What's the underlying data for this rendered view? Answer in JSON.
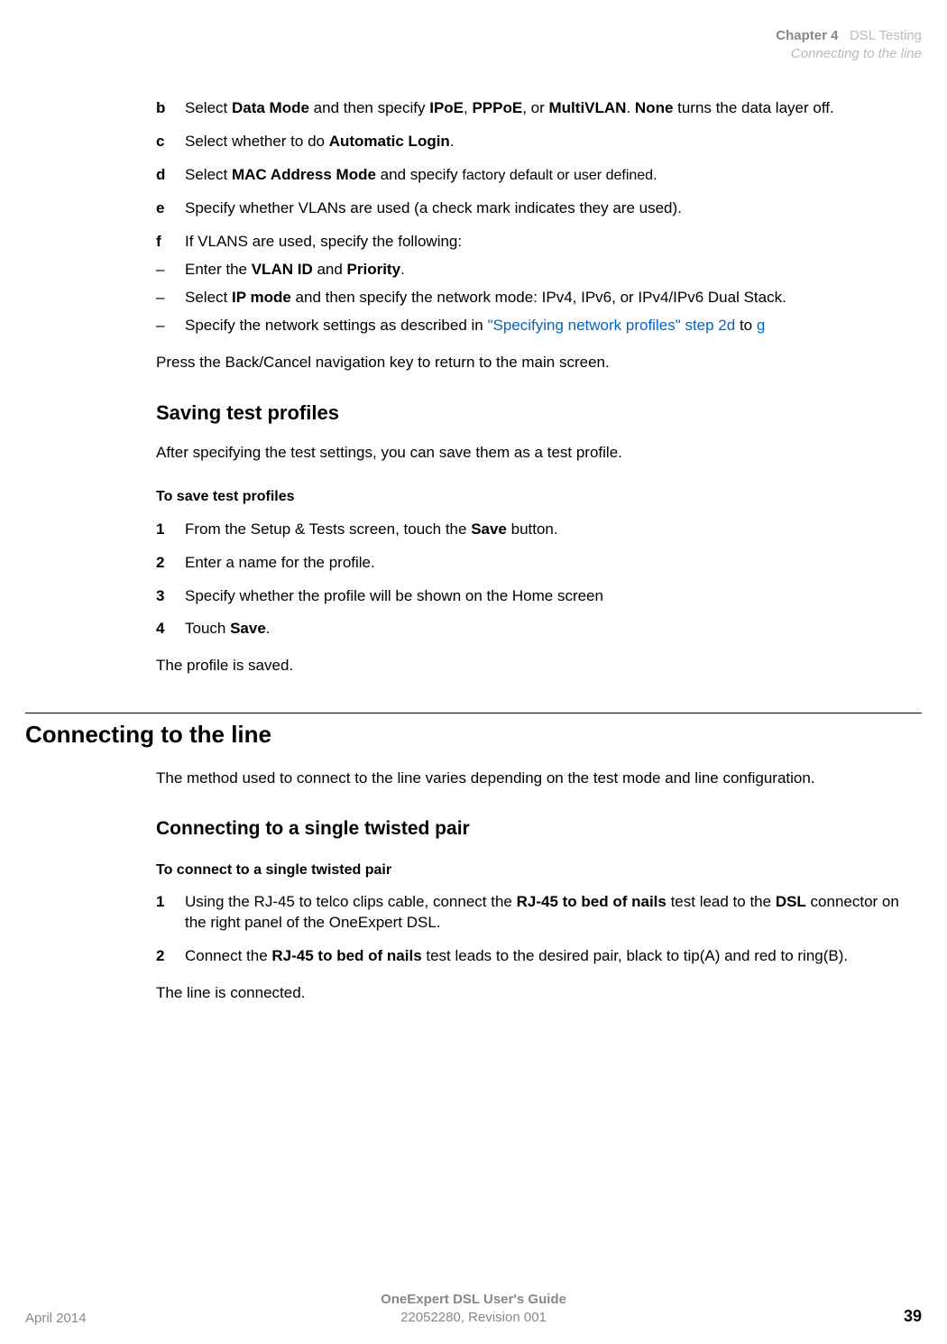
{
  "header": {
    "chapter": "Chapter 4",
    "chapter_title": "DSL Testing",
    "section": "Connecting to the line"
  },
  "intro_steps": {
    "b": {
      "prefix": "Select ",
      "bold1": "Data Mode",
      "mid1": " and then specify ",
      "bold2": "IPoE",
      "mid2": ", ",
      "bold3": "PPPoE",
      "mid3": ", or ",
      "bold4": "MultiVLAN",
      "mid4": ". ",
      "bold5": "None",
      "suffix": " turns the data layer off."
    },
    "c": {
      "prefix": "Select whether to do ",
      "bold1": "Automatic Login",
      "suffix": "."
    },
    "d": {
      "prefix": "Select ",
      "bold1": "MAC Address Mode",
      "mid1": " and specify ",
      "small": "factory default or user defined.",
      "suffix": ""
    },
    "e": {
      "text": "Specify whether VLANs are used (a check mark indicates they are used)."
    },
    "f": {
      "text": "If VLANS are used, specify the following:"
    }
  },
  "sublist": {
    "s1": {
      "prefix": "Enter the ",
      "bold1": "VLAN ID",
      "mid1": " and ",
      "bold2": "Priority",
      "suffix": "."
    },
    "s2": {
      "prefix": "Select ",
      "bold1": "IP mode",
      "suffix": " and then specify the network mode: IPv4, IPv6, or IPv4/IPv6 Dual Stack."
    },
    "s3": {
      "prefix": "Specify the network settings as described in ",
      "link1": "\"Specifying network profiles\" step 2d",
      "mid": " to ",
      "link2": "g"
    }
  },
  "para_back": "Press the Back/Cancel navigation key to return to the main screen.",
  "saving": {
    "heading": "Saving test profiles",
    "intro": "After specifying the test settings, you can save them as a test profile.",
    "subhead": "To save test profiles",
    "step1": {
      "prefix": "From the Setup & Tests screen, touch the ",
      "bold": "Save",
      "suffix": " button."
    },
    "step2": "Enter a name for the profile.",
    "step3": "Specify whether the profile will be shown on the Home screen",
    "step4": {
      "prefix": "Touch ",
      "bold": "Save",
      "suffix": "."
    },
    "outro": "The profile is saved."
  },
  "connecting": {
    "heading": "Connecting to the line",
    "intro": "The method used to connect to the line varies depending on the test mode and line configuration.",
    "sub_heading": "Connecting to a single twisted pair",
    "sub_subhead": "To connect to a single twisted pair",
    "step1": {
      "prefix": "Using the RJ-45 to telco clips cable, connect the ",
      "bold1": "RJ-45 to bed of nails",
      "mid1": " test lead to the ",
      "bold2": "DSL",
      "suffix": " connector on the right panel of the OneExpert DSL."
    },
    "step2": {
      "prefix": "Connect the ",
      "bold1": "RJ-45 to bed of nails",
      "suffix": " test leads to the desired pair, black to tip(A) and red to ring(B)."
    },
    "outro": "The line is connected."
  },
  "footer": {
    "left": "April 2014",
    "center1": "OneExpert DSL User's Guide",
    "center2": "22052280, Revision 001",
    "page": "39"
  }
}
